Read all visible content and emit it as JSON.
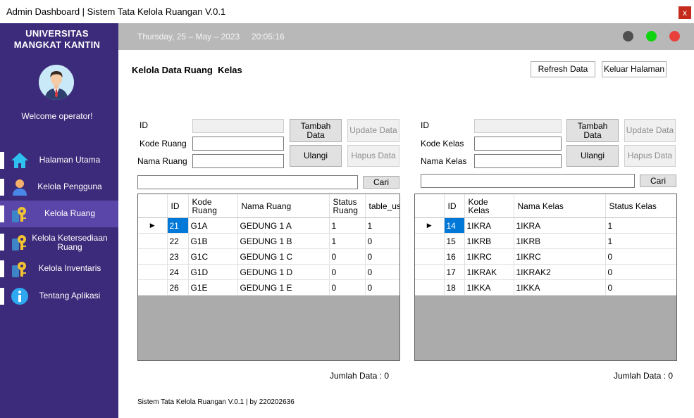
{
  "window": {
    "title": "Admin Dashboard | Sistem Tata Kelola Ruangan V.0.1",
    "close_label": "x"
  },
  "sidebar": {
    "university_line1": "UNIVERSITAS",
    "university_line2": "MANGKAT KANTIN",
    "welcome": "Welcome operator!",
    "items": [
      {
        "label": "Halaman Utama",
        "icon": "home-icon"
      },
      {
        "label": "Kelola Pengguna",
        "icon": "user-icon"
      },
      {
        "label": "Kelola Ruang",
        "icon": "key-icon",
        "active": true
      },
      {
        "label": "Kelola Ketersediaan Ruang",
        "icon": "key-icon"
      },
      {
        "label": "Kelola Inventaris",
        "icon": "key-icon"
      },
      {
        "label": "Tentang Aplikasi",
        "icon": "info-icon"
      }
    ]
  },
  "header": {
    "date": "Thursday, 25 – May – 2023",
    "time": "20:05:16",
    "dots": [
      "#505050",
      "#11d411",
      "#e8413c"
    ]
  },
  "page": {
    "heading": "Kelola Data Ruang  Kelas",
    "refresh_button": "Refresh Data",
    "exit_button": "Keluar Halaman",
    "footer": "Sistem Tata Kelola Ruangan V.0.1 | by 220202636"
  },
  "ruang": {
    "label_id": "ID",
    "label_kode": "Kode Ruang",
    "label_nama": "Nama Ruang",
    "id_value": "",
    "kode_value": "",
    "nama_value": "",
    "search_value": "",
    "tambah_button": "Tambah Data",
    "update_button": "Update Data",
    "ulangi_button": "Ulangi",
    "hapus_button": "Hapus Data",
    "cari_button": "Cari",
    "columns": [
      "ID",
      "Kode Ruang",
      "Nama Ruang",
      "Status Ruang",
      "table_use"
    ],
    "rows": [
      [
        "21",
        "G1A",
        "GEDUNG 1 A",
        "1",
        "1"
      ],
      [
        "22",
        "G1B",
        "GEDUNG 1 B",
        "1",
        "0"
      ],
      [
        "23",
        "G1C",
        "GEDUNG 1 C",
        "0",
        "0"
      ],
      [
        "24",
        "G1D",
        "GEDUNG 1 D",
        "0",
        "0"
      ],
      [
        "26",
        "G1E",
        "GEDUNG 1 E",
        "0",
        "0"
      ]
    ],
    "jumlah": "Jumlah Data : 0"
  },
  "kelas": {
    "label_id": "ID",
    "label_kode": "Kode Kelas",
    "label_nama": "Nama Kelas",
    "id_value": "",
    "kode_value": "",
    "nama_value": "",
    "search_value": "",
    "tambah_button": "Tambah Data",
    "update_button": "Update Data",
    "ulangi_button": "Ulangi",
    "hapus_button": "Hapus Data",
    "cari_button": "Cari",
    "columns": [
      "ID",
      "Kode Kelas",
      "Nama Kelas",
      "Status Kelas"
    ],
    "rows": [
      [
        "14",
        "1IKRA",
        "1IKRA",
        "1"
      ],
      [
        "15",
        "1IKRB",
        "1IKRB",
        "1"
      ],
      [
        "16",
        "1IKRC",
        "1IKRC",
        "0"
      ],
      [
        "17",
        "1IKRAK",
        "1IKRAK2",
        "0"
      ],
      [
        "18",
        "1IKKA",
        "1IKKA",
        "0"
      ]
    ],
    "jumlah": "Jumlah Data : 0"
  }
}
